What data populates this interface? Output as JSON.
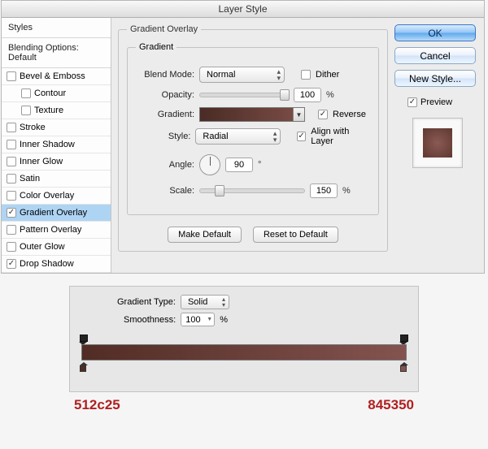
{
  "window": {
    "title": "Layer Style"
  },
  "sidebar": {
    "heading": "Styles",
    "blending_label": "Blending Options: Default",
    "items": [
      {
        "label": "Bevel & Emboss",
        "checked": false,
        "indent": false
      },
      {
        "label": "Contour",
        "checked": false,
        "indent": true
      },
      {
        "label": "Texture",
        "checked": false,
        "indent": true
      },
      {
        "label": "Stroke",
        "checked": false,
        "indent": false
      },
      {
        "label": "Inner Shadow",
        "checked": false,
        "indent": false
      },
      {
        "label": "Inner Glow",
        "checked": false,
        "indent": false
      },
      {
        "label": "Satin",
        "checked": false,
        "indent": false
      },
      {
        "label": "Color Overlay",
        "checked": false,
        "indent": false
      },
      {
        "label": "Gradient Overlay",
        "checked": true,
        "indent": false,
        "selected": true
      },
      {
        "label": "Pattern Overlay",
        "checked": false,
        "indent": false
      },
      {
        "label": "Outer Glow",
        "checked": false,
        "indent": false
      },
      {
        "label": "Drop Shadow",
        "checked": true,
        "indent": false
      }
    ]
  },
  "panel": {
    "group_title": "Gradient Overlay",
    "inner_title": "Gradient",
    "blend_mode_label": "Blend Mode:",
    "blend_mode_value": "Normal",
    "dither_label": "Dither",
    "dither_checked": false,
    "opacity_label": "Opacity:",
    "opacity_value": "100",
    "opacity_suffix": "%",
    "gradient_label": "Gradient:",
    "reverse_label": "Reverse",
    "reverse_checked": true,
    "style_label": "Style:",
    "style_value": "Radial",
    "align_label": "Align with Layer",
    "align_checked": true,
    "angle_label": "Angle:",
    "angle_value": "90",
    "angle_suffix": "°",
    "scale_label": "Scale:",
    "scale_value": "150",
    "scale_suffix": "%",
    "make_default": "Make Default",
    "reset_default": "Reset to Default"
  },
  "right": {
    "ok": "OK",
    "cancel": "Cancel",
    "new_style": "New Style...",
    "preview_label": "Preview",
    "preview_checked": true
  },
  "editor": {
    "type_label": "Gradient Type:",
    "type_value": "Solid",
    "smooth_label": "Smoothness:",
    "smooth_value": "100",
    "smooth_suffix": "%",
    "left_hex": "512c25",
    "right_hex": "845350",
    "left_color": "#512c25",
    "right_color": "#845350"
  }
}
